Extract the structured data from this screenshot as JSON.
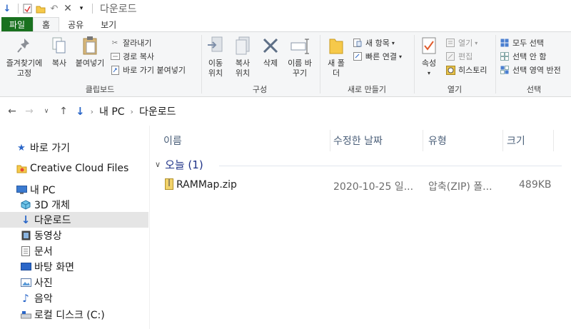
{
  "window": {
    "title": "다운로드"
  },
  "tabs": {
    "file": "파일",
    "home": "홈",
    "share": "공유",
    "view": "보기"
  },
  "ribbon": {
    "clipboard": {
      "pin": "즐겨찾기에 고정",
      "copy": "복사",
      "paste": "붙여넣기",
      "cut": "잘라내기",
      "copy_path": "경로 복사",
      "paste_shortcut": "바로 가기 붙여넣기",
      "label": "클립보드"
    },
    "organize": {
      "move_to": "이동 위치",
      "copy_to": "복사 위치",
      "delete": "삭제",
      "rename": "이름 바꾸기",
      "label": "구성"
    },
    "new": {
      "new_folder": "새 폴더",
      "new_item": "새 항목",
      "easy_access": "빠른 연결",
      "label": "새로 만들기"
    },
    "open": {
      "properties": "속성",
      "open": "열기",
      "edit": "편집",
      "history": "히스토리",
      "label": "열기"
    },
    "select": {
      "select_all": "모두 선택",
      "select_none": "선택 안 함",
      "invert": "선택 영역 반전",
      "label": "선택"
    }
  },
  "address": {
    "root": "내 PC",
    "current": "다운로드"
  },
  "nav": {
    "quick_access": "바로 가기",
    "creative_cloud": "Creative Cloud Files",
    "this_pc": "내 PC",
    "objects3d": "3D 개체",
    "downloads": "다운로드",
    "videos": "동영상",
    "documents": "문서",
    "desktop": "바탕 화면",
    "pictures": "사진",
    "music": "음악",
    "local_disk": "로컬 디스크 (C:)"
  },
  "columns": {
    "name": "이름",
    "modified": "수정한 날짜",
    "type": "유형",
    "size": "크기"
  },
  "groups": [
    {
      "header": "오늘 (1)",
      "files": [
        {
          "name": "RAMMap.zip",
          "modified": "2020-10-25 일...",
          "type": "압축(ZIP) 폴...",
          "size": "489KB"
        }
      ]
    }
  ],
  "colors": {
    "file_tab": "#19711f",
    "group_header": "#1e3287",
    "selected_nav": "#e5e5e5",
    "download_arrow": "#2a66c8"
  }
}
